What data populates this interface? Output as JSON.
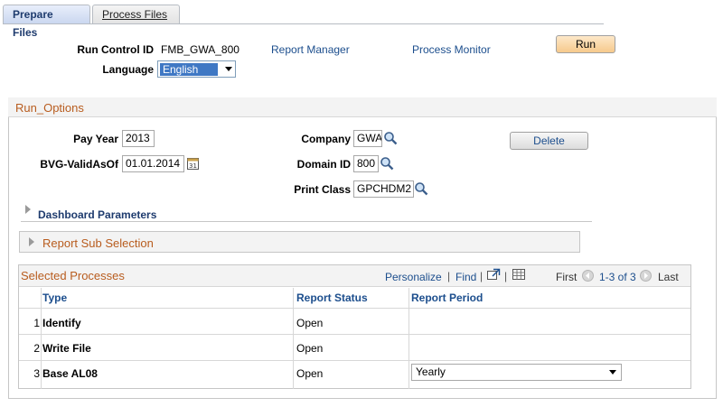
{
  "tabs": [
    {
      "label": "Prepare Files",
      "active": true
    },
    {
      "label": "Process Files",
      "active": false
    }
  ],
  "header": {
    "run_control_label": "Run Control ID",
    "run_control_value": "FMB_GWA_800",
    "report_manager": "Report Manager",
    "process_monitor": "Process Monitor",
    "run_button": "Run",
    "language_label": "Language",
    "language_value": "English"
  },
  "run_options": {
    "title": "Run_Options",
    "pay_year_label": "Pay Year",
    "pay_year_value": "2013",
    "bvg_label": "BVG-ValidAsOf",
    "bvg_value": "01.01.2014",
    "company_label": "Company",
    "company_value": "GWA",
    "domain_label": "Domain ID",
    "domain_value": "800",
    "print_class_label": "Print Class",
    "print_class_value": "GPCHDM2",
    "delete_button": "Delete",
    "dashboard": "Dashboard Parameters",
    "report_sub": "Report Sub Selection"
  },
  "grid": {
    "title": "Selected Processes",
    "personalize": "Personalize",
    "separator": "|",
    "find": "Find",
    "first": "First",
    "range": "1-3 of 3",
    "last": "Last",
    "columns": [
      "Type",
      "Report Status",
      "Report Period"
    ],
    "rows": [
      {
        "num": "1",
        "type": "Identify",
        "status": "Open",
        "period": ""
      },
      {
        "num": "2",
        "type": "Write File",
        "status": "Open",
        "period": ""
      },
      {
        "num": "3",
        "type": "Base AL08",
        "status": "Open",
        "period": "Yearly"
      }
    ]
  },
  "icons": {
    "lookup": "magnifier-icon",
    "calendar": "calendar-icon",
    "expand": "triangle-right-icon",
    "new_window": "new-window-icon",
    "download": "spreadsheet-icon"
  }
}
